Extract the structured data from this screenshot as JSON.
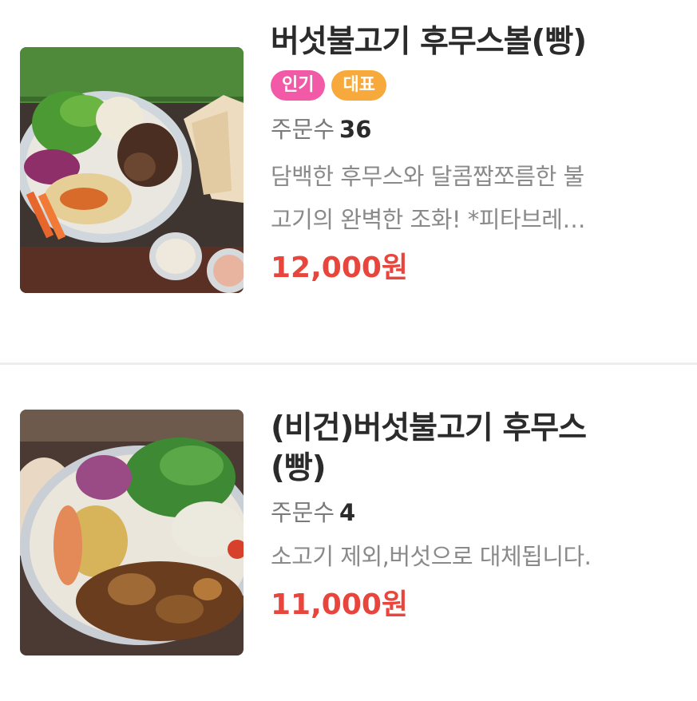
{
  "menu_items": [
    {
      "title": "버섯불고기 후무스볼(빵)",
      "badges": [
        "인기",
        "대표"
      ],
      "orders_label": "주문수",
      "orders_count": "36",
      "description_line1": "담백한 후무스와 달콤짭쪼름한 불",
      "description_line2": "고기의 완벽한 조화! *피타브레…",
      "price": "12,000원",
      "image_icon": "bulgogi-hummus-bowl-photo"
    },
    {
      "title_line1": "(비건)버섯불고기 후무스",
      "title_line2": "(빵)",
      "orders_label": "주문수",
      "orders_count": "4",
      "description_line1": "소고기 제외,버섯으로 대체됩니다.",
      "price": "11,000원",
      "image_icon": "vegan-mushroom-hummus-photo"
    }
  ],
  "colors": {
    "price": "#e8453c",
    "badge_popular": "#f25aa8",
    "badge_signature": "#f7a93b"
  }
}
